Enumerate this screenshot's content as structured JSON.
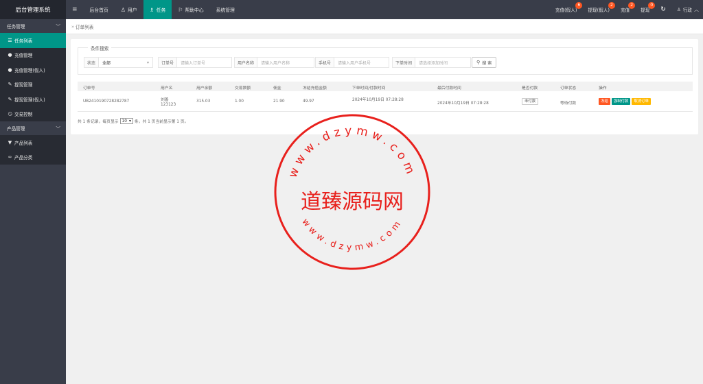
{
  "app": {
    "title": "后台管理系统"
  },
  "topnav": {
    "menu_icon": "menu-icon",
    "items": [
      {
        "label": "后台首页",
        "icon": ""
      },
      {
        "label": "用户",
        "icon": "user-icon"
      },
      {
        "label": "任务",
        "icon": "task-icon"
      },
      {
        "label": "帮助中心",
        "icon": "flag-icon"
      },
      {
        "label": "系统管理",
        "icon": ""
      }
    ],
    "right": [
      {
        "label": "充值(假人)",
        "badge": "6"
      },
      {
        "label": "提现(假人)",
        "badge": "2"
      },
      {
        "label": "充值",
        "badge": "2"
      },
      {
        "label": "提现",
        "badge": "0"
      }
    ],
    "refresh_icon": "refresh-icon",
    "admin": {
      "label": "行政",
      "icon": "user-icon",
      "caret": "chevron-up-icon"
    }
  },
  "sidebar": {
    "groups": [
      {
        "label": "任务管理",
        "items": [
          {
            "label": "任务列表",
            "icon": "list-icon"
          },
          {
            "label": "充值管理",
            "icon": "chat-icon"
          },
          {
            "label": "充值管理(假人)",
            "icon": "chat-icon"
          },
          {
            "label": "提现管理",
            "icon": "wrench-icon"
          },
          {
            "label": "提现管理(假人)",
            "icon": "wrench-icon"
          },
          {
            "label": "交易控制",
            "icon": "clock-icon"
          }
        ]
      },
      {
        "label": "产品管理",
        "items": [
          {
            "label": "产品列表",
            "icon": "cart-icon"
          },
          {
            "label": "产品分类",
            "icon": "link-icon"
          }
        ]
      }
    ]
  },
  "breadcrumb": {
    "sep": "»",
    "current": "订单列表"
  },
  "filter": {
    "legend": "条件搜索",
    "status_label": "状态",
    "status_value": "全部",
    "order_label": "订单号",
    "order_placeholder": "请输入订单号",
    "username_label": "用户名称",
    "username_placeholder": "请输入用户名称",
    "phone_label": "手机号",
    "phone_placeholder": "请输入用户手机号",
    "time_label": "下单时间",
    "time_placeholder": "请选择添加时间",
    "search_label": "搜 索"
  },
  "table": {
    "headers": [
      "订单号",
      "用户名",
      "用户余额",
      "交易数额",
      "佣金",
      "冻结充值金额",
      "下单时间/付款时间",
      "最后付款时间",
      "是否付款",
      "订单状态",
      "操作"
    ],
    "rows": [
      {
        "order_no": "UB2410190728282787",
        "username": "刘善",
        "user_id": "123123",
        "balance": "315.03",
        "amount": "1.00",
        "commission": "21.90",
        "frozen": "49.97",
        "order_time": "2024年10月19日 07:28:28",
        "last_pay_time": "2024年10月19日 07:28:28",
        "paid": "未付款",
        "status": "等待付款",
        "actions": [
          "冻结",
          "强制付款",
          "取消订单"
        ]
      }
    ]
  },
  "pager": {
    "prefix": "共 1 条记录，每页显示",
    "page_size": "10",
    "suffix": "条，共 1 页当前显示第 1 页。"
  },
  "stamp": {
    "url_top": "www.dzymw.com",
    "name": "道臻源码网",
    "url_bottom": "www.dzymw.com"
  },
  "colors": {
    "topbar": "#393d49",
    "accent": "#009688",
    "badge": "#ff5722",
    "btn_freeze": "#ff5722",
    "btn_force": "#009688",
    "btn_cancel": "#ffb800",
    "stamp": "#e8201c"
  }
}
